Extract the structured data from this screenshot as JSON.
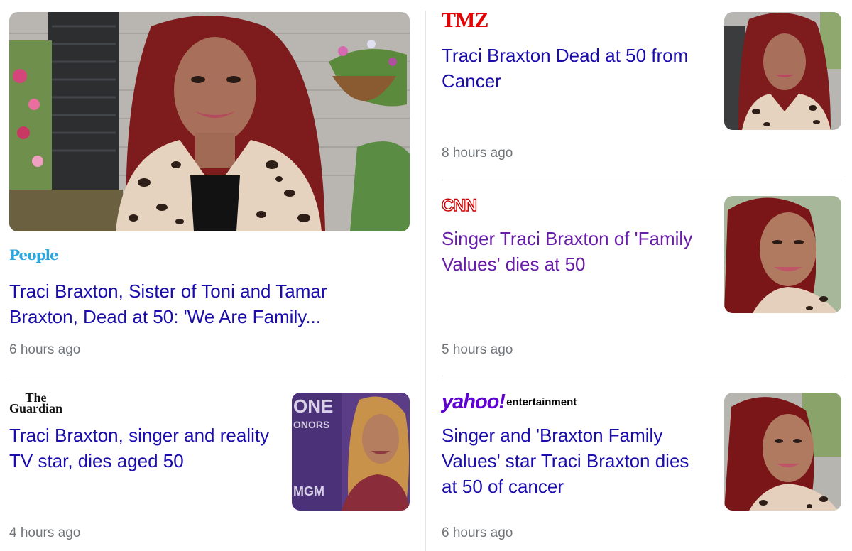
{
  "articles": [
    {
      "id": "people",
      "source": "People",
      "title": "Traci Braxton, Sister of Toni and Tamar Braxton, Dead at 50: 'We Are Family...",
      "time": "6 hours ago"
    },
    {
      "id": "tmz",
      "source": "TMZ",
      "title": "Traci Braxton Dead at 50 from Cancer",
      "time": "8 hours ago"
    },
    {
      "id": "cnn",
      "source": "CNN",
      "title": "Singer Traci Braxton of 'Family Values' dies at 50",
      "time": "5 hours ago",
      "visited": true
    },
    {
      "id": "guardian",
      "source_line1": "The",
      "source_line2": "Guardian",
      "title": "Traci Braxton, singer and reality TV star, dies aged 50",
      "time": "4 hours ago"
    },
    {
      "id": "yahoo",
      "source": "yahoo!",
      "source_suffix": "entertainment",
      "title": "Singer and 'Braxton Family Values' star Traci Braxton dies at 50 of cancer",
      "time": "6 hours ago"
    }
  ],
  "colors": {
    "link": "#1a0dab",
    "visited_link": "#681da8",
    "meta_text": "#70757a"
  }
}
